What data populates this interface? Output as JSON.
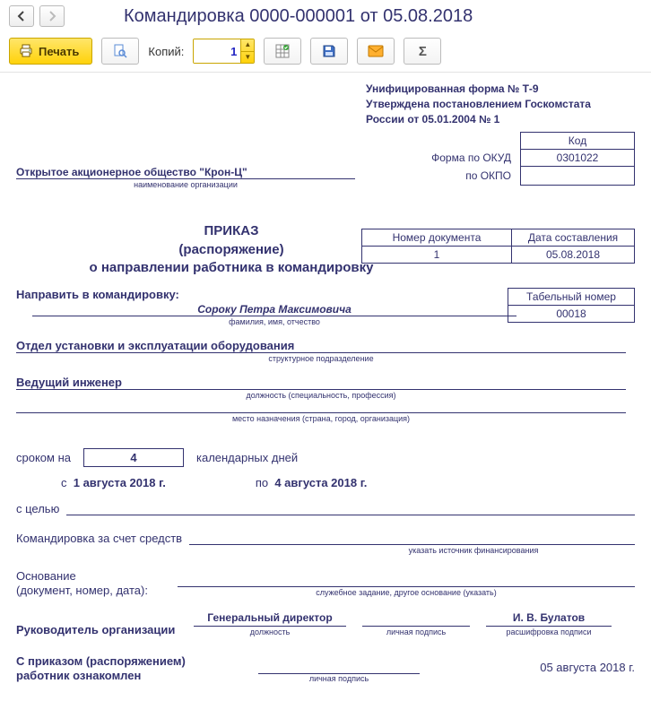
{
  "window_title": "Командировка 0000-000001 от 05.08.2018",
  "toolbar": {
    "print_label": "Печать",
    "copies_label": "Копий:",
    "copies_value": "1"
  },
  "form_header": {
    "line1": "Унифицированная форма № Т-9",
    "line2": "Утверждена постановлением Госкомстата",
    "line3": "России от 05.01.2004 № 1"
  },
  "codes": {
    "kod_label": "Код",
    "okud_label": "Форма по ОКУД",
    "okud_value": "0301022",
    "okpo_label": "по ОКПО",
    "okpo_value": ""
  },
  "org": {
    "name": "Открытое акционерное общество \"Крон-Ц\"",
    "caption": "наименование организации"
  },
  "docnum": {
    "num_label": "Номер документа",
    "date_label": "Дата составления",
    "num": "1",
    "date": "05.08.2018"
  },
  "prikaz": {
    "l1": "ПРИКАЗ",
    "l2": "(распоряжение)",
    "l3": "о направлении работника в командировку"
  },
  "direct_label": "Направить в командировку:",
  "tab_num": {
    "label": "Табельный номер",
    "value": "00018"
  },
  "fio": {
    "value": "Сороку Петра Максимовича",
    "caption": "фамилия, имя, отчество"
  },
  "dept": {
    "value": "Отдел установки и эксплуатации оборудования",
    "caption": "структурное подразделение"
  },
  "post": {
    "value": "Ведущий инженер",
    "caption": "должность (специальность, профессия)"
  },
  "dest": {
    "value": "",
    "caption": "место назначения (страна, город, организация)"
  },
  "period": {
    "prefix": "сроком на",
    "days": "4",
    "suffix": "календарных дней",
    "from_lbl": "с",
    "from": "1 августа 2018 г.",
    "to_lbl": "по",
    "to": "4 августа 2018 г."
  },
  "purpose_label": "с целью",
  "funds": {
    "label": "Командировка за счет средств",
    "caption": "указать источник финансирования"
  },
  "basis": {
    "l1": "Основание",
    "l2": "(документ, номер, дата):",
    "caption": "служебное задание, другое основание (указать)"
  },
  "head": {
    "label": "Руководитель организации",
    "post": "Генеральный директор",
    "post_cap": "должность",
    "sign_cap": "личная подпись",
    "name": "И. В. Булатов",
    "name_cap": "расшифровка подписи"
  },
  "ack": {
    "l1": "С приказом (распоряжением)",
    "l2": "работник ознакомлен",
    "sign_cap": "личная подпись",
    "date": "05 августа 2018 г."
  }
}
